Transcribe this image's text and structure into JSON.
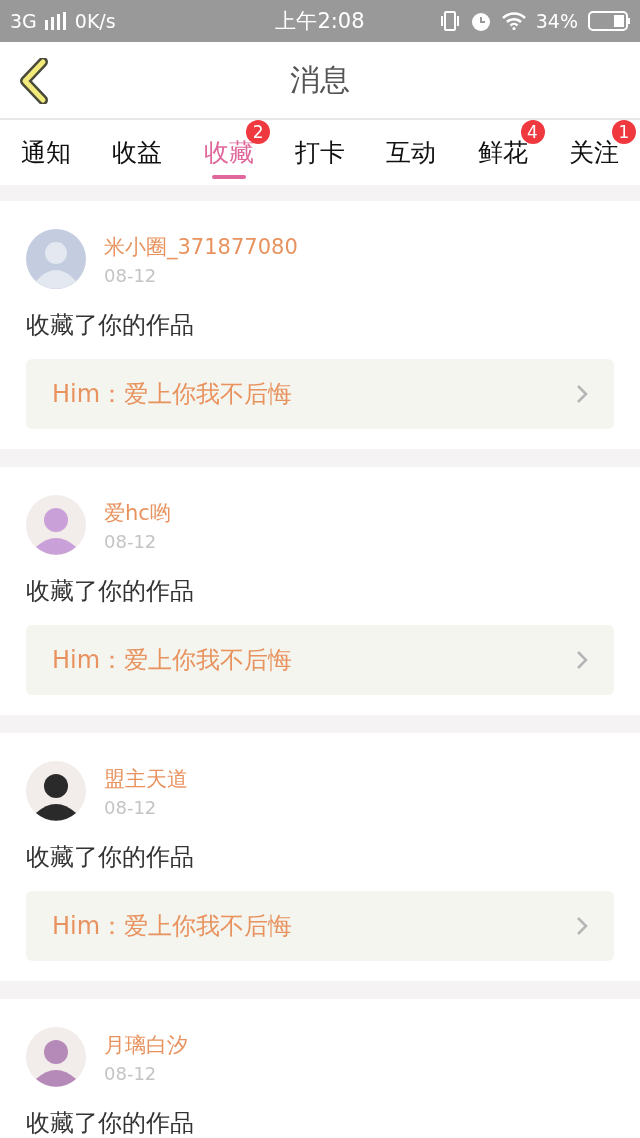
{
  "status_bar": {
    "network": "3G",
    "speed": "0K/s",
    "time": "上午2:08",
    "battery": "34%"
  },
  "header": {
    "title": "消息"
  },
  "tabs": [
    {
      "label": "通知",
      "selected": false
    },
    {
      "label": "收益",
      "selected": false
    },
    {
      "label": "收藏",
      "selected": true,
      "badge": "2"
    },
    {
      "label": "打卡",
      "selected": false
    },
    {
      "label": "互动",
      "selected": false
    },
    {
      "label": "鲜花",
      "selected": false,
      "badge": "4"
    },
    {
      "label": "关注",
      "selected": false,
      "badge": "1"
    }
  ],
  "messages": [
    {
      "kind": "placeholder",
      "name": "米小圈_371877080",
      "date": "08-12",
      "text": "收藏了你的作品",
      "work": "Him：爱上你我不后悔"
    },
    {
      "kind": "photo",
      "color": "#c9a0d8",
      "name": "爱hc哟",
      "date": "08-12",
      "text": "收藏了你的作品",
      "work": "Him：爱上你我不后悔"
    },
    {
      "kind": "photo",
      "color": "#2a2a2a",
      "name": "盟主天道",
      "date": "08-12",
      "text": "收藏了你的作品",
      "work": "Him：爱上你我不后悔"
    },
    {
      "kind": "photo",
      "color": "#b58ab8",
      "name": "月璃白汐",
      "date": "08-12",
      "text": "收藏了你的作品"
    }
  ]
}
